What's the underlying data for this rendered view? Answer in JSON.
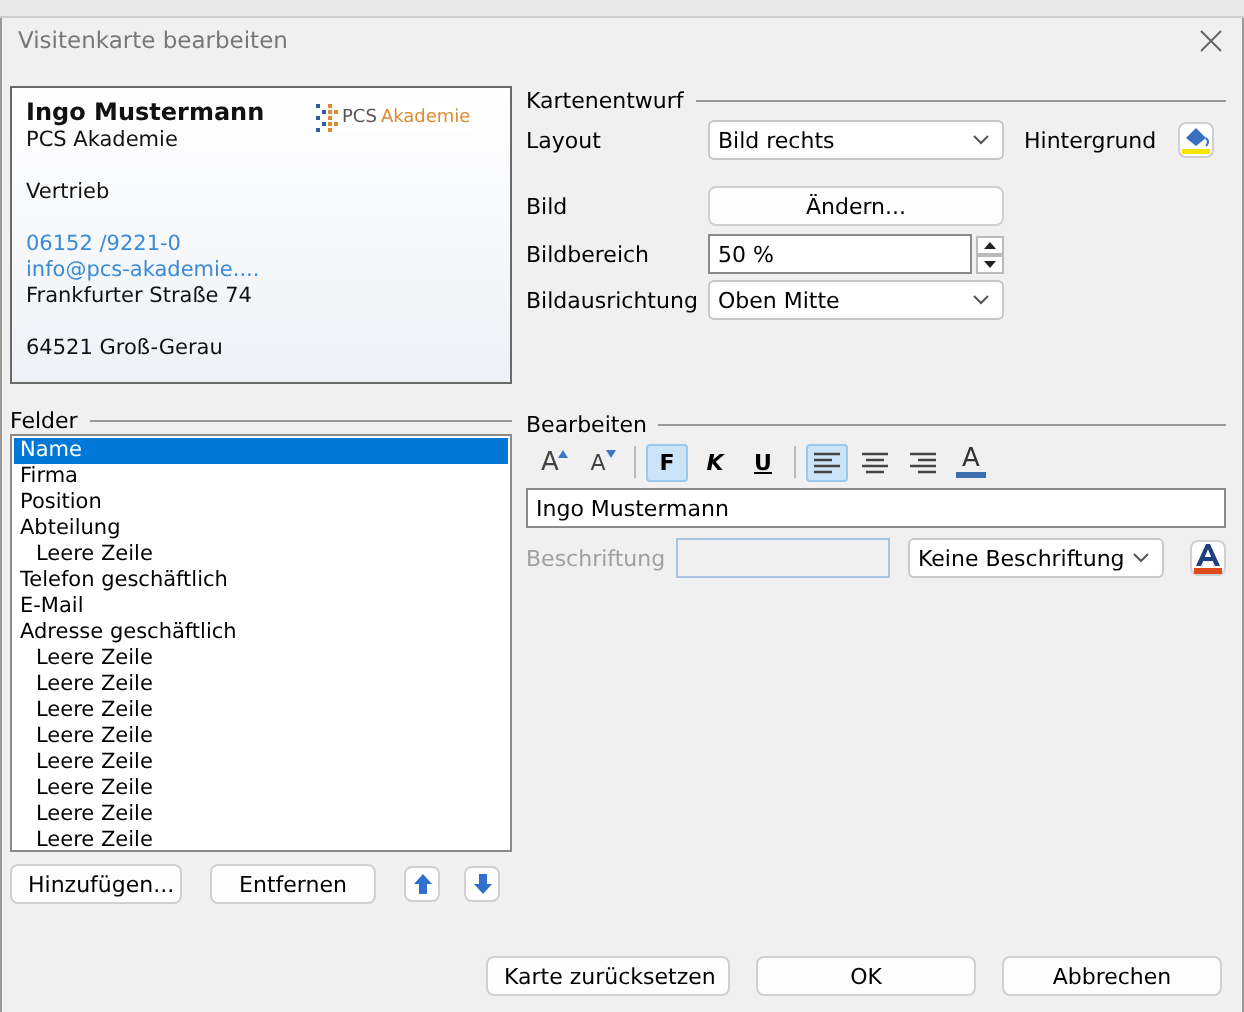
{
  "window": {
    "title": "Visitenkarte bearbeiten"
  },
  "card": {
    "logo": {
      "left": "PCS",
      "right": "Akademie"
    },
    "lines": [
      {
        "kind": "name",
        "text": "Ingo Mustermann"
      },
      {
        "kind": "plain",
        "text": "PCS Akademie"
      },
      {
        "kind": "blank"
      },
      {
        "kind": "plain",
        "text": "Vertrieb"
      },
      {
        "kind": "blank"
      },
      {
        "kind": "link",
        "text": "06152 /9221-0"
      },
      {
        "kind": "link",
        "text": "info@pcs-akademie...."
      },
      {
        "kind": "plain",
        "text": "Frankfurter Straße 74"
      },
      {
        "kind": "blank"
      },
      {
        "kind": "plain",
        "text": "64521  Groß-Gerau"
      }
    ]
  },
  "fields": {
    "title": "Felder",
    "items": [
      {
        "label": "Name",
        "selected": true
      },
      {
        "label": "Firma",
        "selected": false
      },
      {
        "label": "Position",
        "selected": false
      },
      {
        "label": "Abteilung",
        "selected": false,
        "children": [
          {
            "label": "Leere Zeile",
            "selected": false
          }
        ]
      },
      {
        "label": "Telefon geschäftlich",
        "selected": false
      },
      {
        "label": "E-Mail",
        "selected": false
      },
      {
        "label": "Adresse geschäftlich",
        "selected": false,
        "children": [
          {
            "label": "Leere Zeile",
            "selected": false
          },
          {
            "label": "Leere Zeile",
            "selected": false
          },
          {
            "label": "Leere Zeile",
            "selected": false
          },
          {
            "label": "Leere Zeile",
            "selected": false
          },
          {
            "label": "Leere Zeile",
            "selected": false
          },
          {
            "label": "Leere Zeile",
            "selected": false
          },
          {
            "label": "Leere Zeile",
            "selected": false
          },
          {
            "label": "Leere Zeile",
            "selected": false
          }
        ]
      }
    ],
    "buttons": [
      "Hinzufügen...",
      "Entfernen"
    ]
  },
  "design": {
    "title": "Kartenentwurf",
    "layout_label": "Layout",
    "layout_value": "Bild rechts",
    "background_label": "Hintergrund",
    "image_label": "Bild",
    "image_button": "Ändern...",
    "area_label": "Bildbereich",
    "area_value": "50 %",
    "align_label": "Bildausrichtung",
    "align_value": "Oben Mitte"
  },
  "edit": {
    "title": "Bearbeiten",
    "toolbar": [
      {
        "kind": "grow",
        "label": "A",
        "pressed": false
      },
      {
        "kind": "shrink",
        "label": "A",
        "pressed": false
      },
      {
        "kind": "sep"
      },
      {
        "kind": "bold",
        "label": "F",
        "pressed": true
      },
      {
        "kind": "italic",
        "label": "K",
        "pressed": false
      },
      {
        "kind": "underline",
        "label": "U",
        "pressed": false
      },
      {
        "kind": "sep"
      },
      {
        "kind": "align-left",
        "pressed": true
      },
      {
        "kind": "align-center",
        "pressed": false
      },
      {
        "kind": "align-right",
        "pressed": false
      },
      {
        "kind": "color",
        "label": "A",
        "pressed": false
      }
    ],
    "text_value": "Ingo Mustermann",
    "caption_label": "Beschriftung",
    "caption_disabled": true,
    "caption_position": "Keine Beschriftung"
  },
  "buttons": {
    "reset": "Karte zurücksetzen",
    "ok": "OK",
    "cancel": "Abbrechen"
  }
}
